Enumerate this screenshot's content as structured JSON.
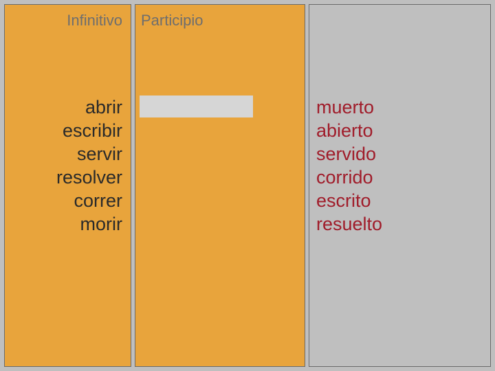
{
  "headers": {
    "infinitive": "Infinitivo",
    "participle": "Participio"
  },
  "infinitives": [
    "abrir",
    "escribir",
    "servir",
    "resolver",
    "correr",
    "morir"
  ],
  "participles": [
    "muerto",
    "abierto",
    "servido",
    "corrido",
    "escrito",
    "resuelto"
  ]
}
